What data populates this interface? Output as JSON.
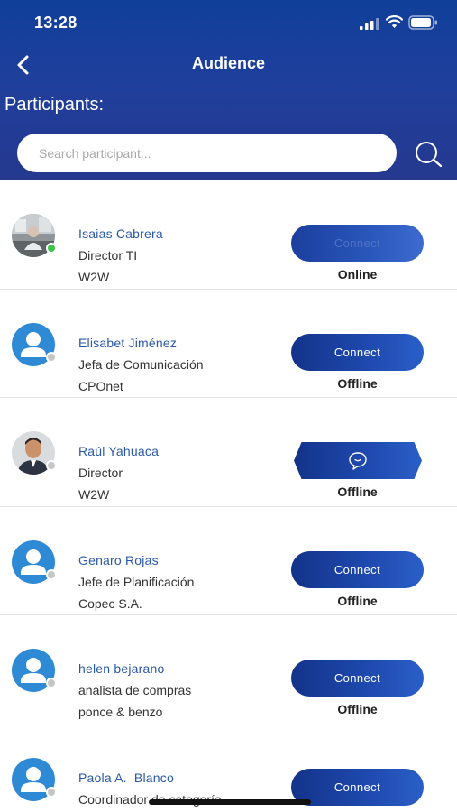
{
  "status_bar": {
    "time": "13:28"
  },
  "header": {
    "title": "Audience",
    "participants_label": "Participants:",
    "search_placeholder": "Search participant..."
  },
  "participants": [
    {
      "name": "Isaias Cabrera",
      "role": "Director TI",
      "company": "W2W",
      "action": "Connect",
      "status": "Online",
      "avatar": "photo"
    },
    {
      "name": "Elisabet Jiménez",
      "role": "Jefa de Comunicación",
      "company": "CPOnet",
      "action": "Connect",
      "status": "Offline",
      "avatar": "default-user"
    },
    {
      "name": "Raúl Yahuaca",
      "role": "Director",
      "company": "W2W",
      "action": "chat",
      "status": "Offline",
      "avatar": "photo"
    },
    {
      "name": "Genaro Rojas",
      "role": "Jefe de Planificación",
      "company": "Copec S.A.",
      "action": "Connect",
      "status": "Offline",
      "avatar": "default-user"
    },
    {
      "name": "helen bejarano",
      "role": "analista de compras",
      "company": "ponce & benzo",
      "action": "Connect",
      "status": "Offline",
      "avatar": "default-user"
    },
    {
      "name": "Paola A.  Blanco",
      "role": "Coordinador de categoría",
      "company": "",
      "action": "Connect",
      "status": "",
      "avatar": "default-user"
    }
  ],
  "icons": {
    "back": "chevron-left-icon",
    "search": "search-icon",
    "chat": "chat-bubble-icon",
    "signal": "signal-icon",
    "wifi": "wifi-icon",
    "battery": "battery-icon"
  },
  "colors": {
    "header_dark": "#0f3f9a",
    "accent_blue": "#1f4ab0",
    "name_blue": "#2a58a8",
    "online": "#3bc44a",
    "offline": "#c6c6c6"
  }
}
